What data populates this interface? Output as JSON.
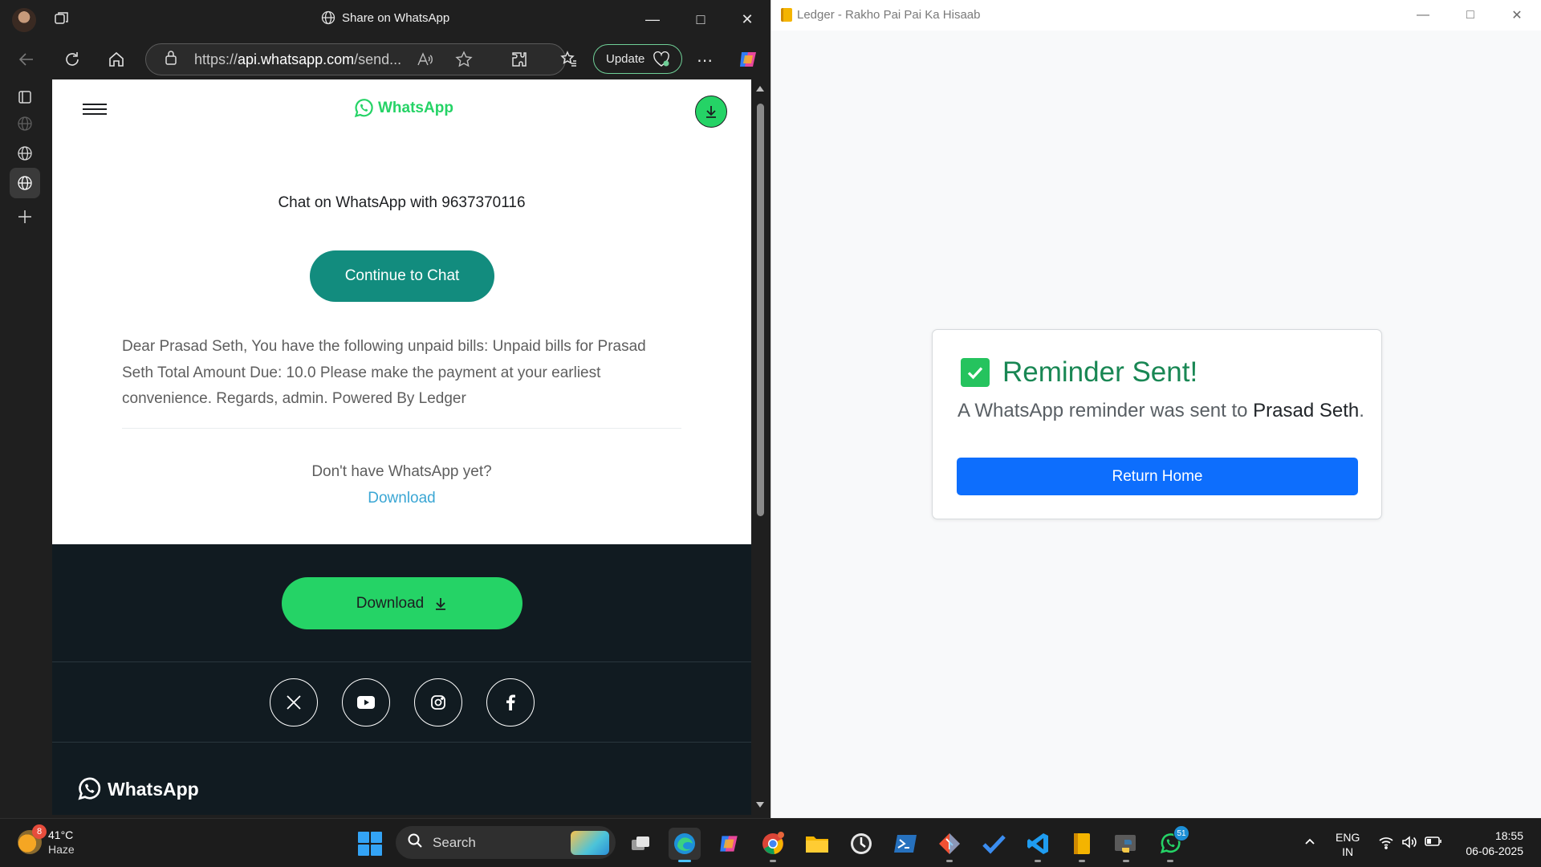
{
  "edge": {
    "title": "Share on WhatsApp",
    "url_prefix": "https://",
    "url_host": "api.whatsapp.com",
    "url_rest": "/send...",
    "update_label": "Update"
  },
  "whatsapp_page": {
    "logo_text": "WhatsApp",
    "chat_with": "Chat on WhatsApp with 9637370116",
    "continue_label": "Continue to Chat",
    "message": "Dear Prasad Seth, You have the following unpaid bills: Unpaid bills for Prasad Seth Total Amount Due: 10.0 Please make the payment at your earliest convenience. Regards, admin. Powered By Ledger",
    "no_whatsapp": "Don't have WhatsApp yet?",
    "download_link": "Download",
    "footer_download": "Download",
    "footer_logo": "WhatsApp",
    "accent": "#25d366",
    "teal": "#128c7e"
  },
  "ledger": {
    "title": "Ledger - Rakho Pai Pai Ka Hisaab",
    "heading": "Reminder Sent!",
    "text_prefix": "A WhatsApp reminder was sent to ",
    "recipient": "Prasad Seth",
    "text_suffix": ".",
    "return_label": "Return Home",
    "primary_color": "#0d6efd",
    "success_color": "#198754"
  },
  "taskbar": {
    "weather_badge": "8",
    "temperature": "41°C",
    "condition": "Haze",
    "search_label": "Search",
    "whatsapp_badge": "51",
    "lang_1": "ENG",
    "lang_2": "IN",
    "time": "18:55",
    "date": "06-06-2025"
  }
}
